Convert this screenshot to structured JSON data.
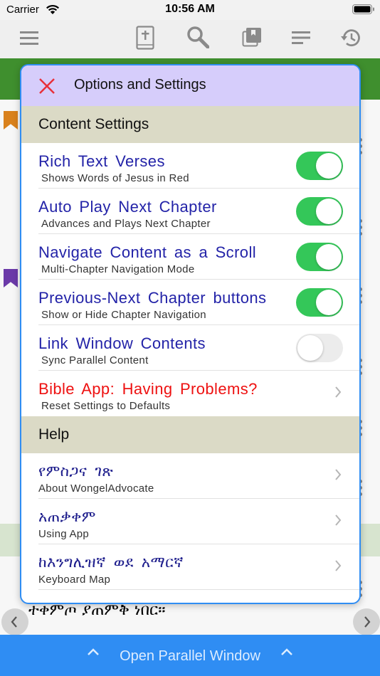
{
  "status_bar": {
    "carrier": "Carrier",
    "time": "10:56 AM"
  },
  "toolbar": {
    "icons": [
      "menu-icon",
      "bible-book-icon",
      "search-icon",
      "library-icon",
      "text-lines-icon",
      "history-icon"
    ]
  },
  "modal": {
    "title": "Options and Settings",
    "sections": {
      "content": "Content Settings",
      "help": "Help"
    },
    "settings": [
      {
        "title": "Rich Text Verses",
        "subtitle": "Shows Words of Jesus in Red",
        "enabled": true
      },
      {
        "title": "Auto Play Next Chapter",
        "subtitle": "Advances and Plays Next Chapter",
        "enabled": true
      },
      {
        "title": "Navigate Content as a Scroll",
        "subtitle": "Multi-Chapter Navigation Mode",
        "enabled": true
      },
      {
        "title": "Previous-Next Chapter buttons",
        "subtitle": "Show or Hide Chapter Navigation",
        "enabled": true
      },
      {
        "title": "Link Window Contents",
        "subtitle": "Sync Parallel Content",
        "enabled": false
      }
    ],
    "problem_row": {
      "title": "Bible App: Having Problems?",
      "subtitle": "Reset Settings to Defaults"
    },
    "help_items": [
      {
        "title": "የምስጋና ገጽ",
        "subtitle": "About WongelAdvocate"
      },
      {
        "title": "አጠቃቀም",
        "subtitle": "Using App"
      },
      {
        "title": "ከእንግሊዝኛ ወደ አማርኛ",
        "subtitle": "Keyboard Map"
      }
    ]
  },
  "background": {
    "verse_text": "ተቀምጦ ያጠምቅ ነበር።"
  },
  "bottom_bar": {
    "label": "Open Parallel Window"
  },
  "colors": {
    "accent_blue": "#2f8df3",
    "toggle_on": "#34c759",
    "toolbar_green": "#3f8f2e",
    "header_lavender": "#d6cdfb",
    "section_bg": "#dbdac6",
    "title_blue": "#2323a8",
    "alert_red": "#ee1111"
  }
}
